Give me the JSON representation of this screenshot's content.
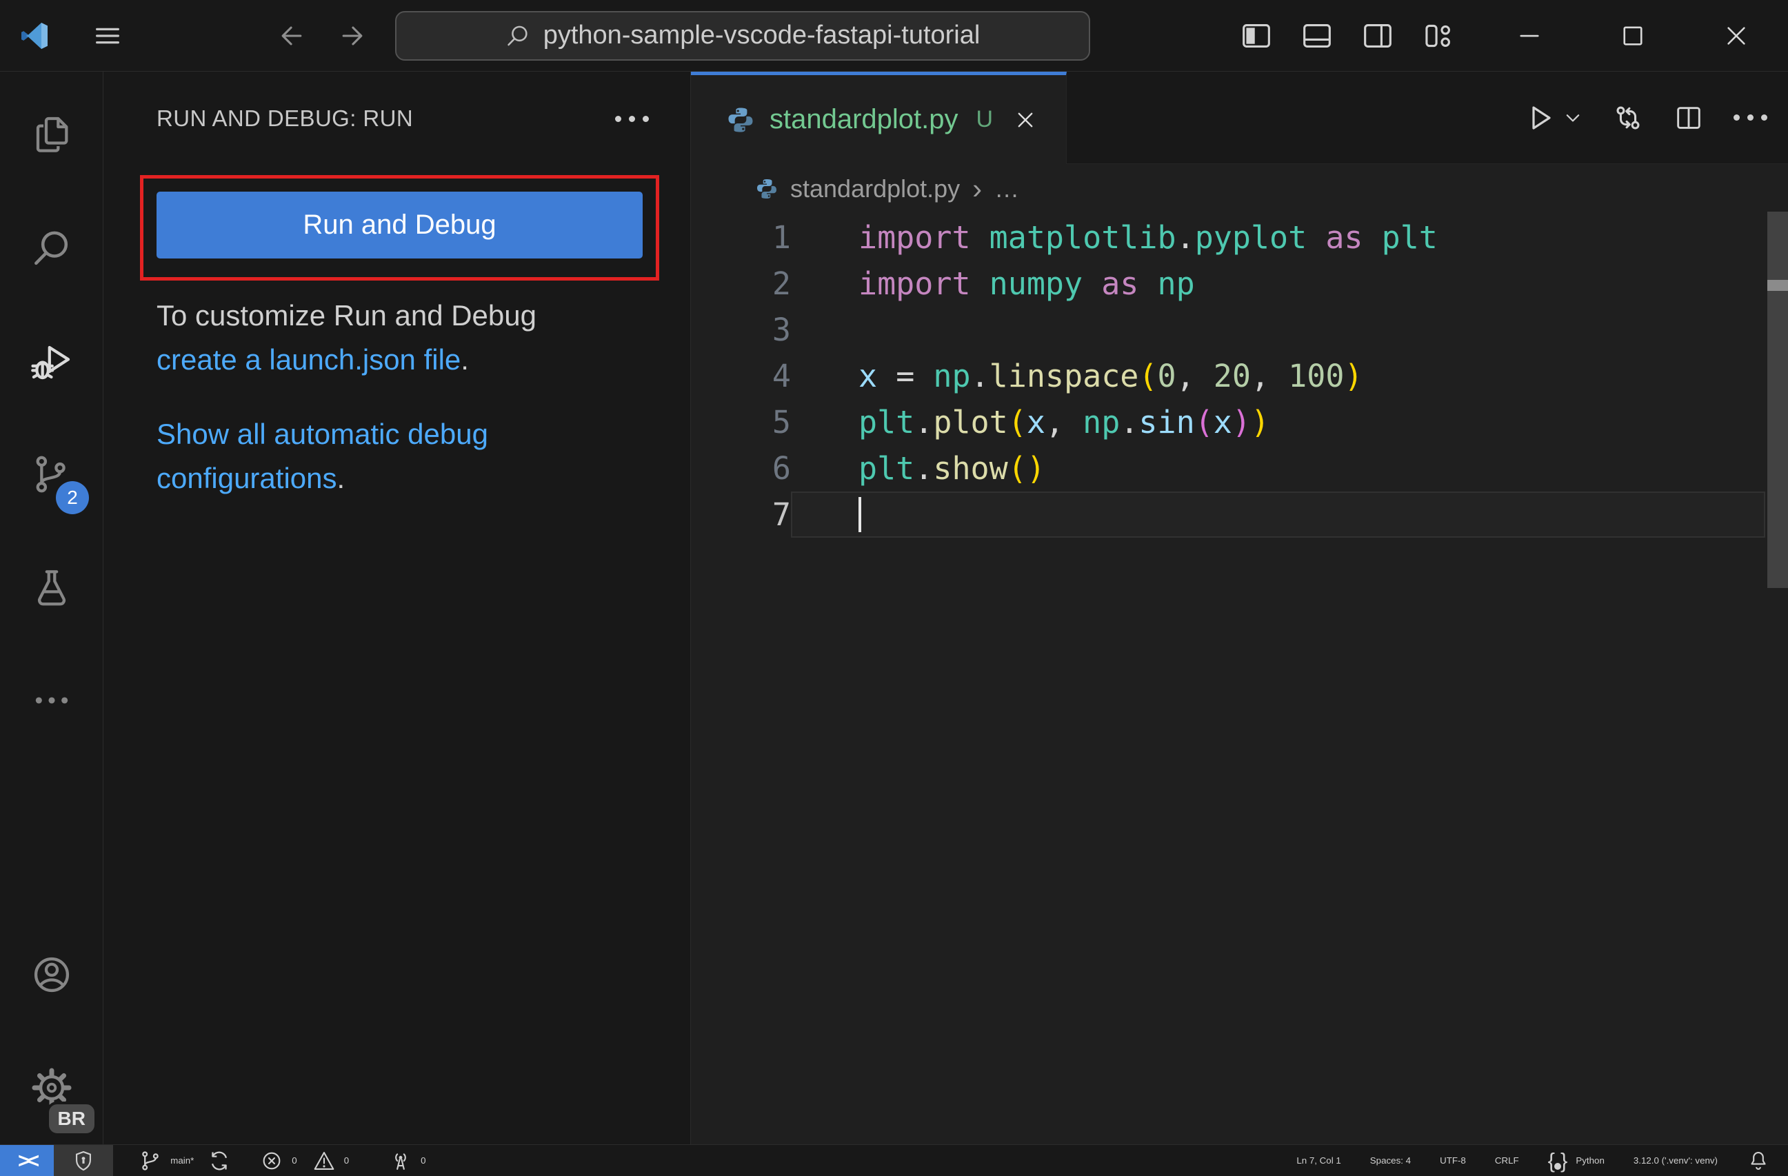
{
  "colors": {
    "bg": "#181818",
    "bg-editor": "#1f1f1f",
    "border": "#2b2b2b",
    "accent": "#3f7dd6",
    "link": "#4daafc",
    "untracked": "#73c991",
    "annotation": "#e32222"
  },
  "syntax_colors": {
    "kw": "#C586C0",
    "cls": "#4EC9B0",
    "fn": "#DCDCAA",
    "var": "#9CDCFE",
    "num": "#B5CEA8",
    "fg": "#D4D4D4",
    "b1": "#FFD700",
    "b2": "#DA70D6"
  },
  "icons": {
    "close": "✕",
    "breadcrumb_separator": "›",
    "breadcrumb_ellipsis": "…",
    "remote": "><",
    "brace_left": "{",
    "brace_right": "}"
  },
  "title_bar": {
    "search_value": "python-sample-vscode-fastapi-tutorial"
  },
  "activity_bar": {
    "source_control_badge": "2",
    "profile_badge": "BR"
  },
  "sidebar": {
    "header": "RUN AND DEBUG: RUN",
    "run_button_label": "Run and Debug",
    "customize_text": "To customize Run and Debug",
    "create_launch_link": "create a launch.json file",
    "create_launch_suffix": ".",
    "show_configs_link": "Show all automatic debug configurations",
    "show_configs_suffix": "."
  },
  "editor": {
    "tab": {
      "filename": "standardplot.py",
      "git_status": "U"
    },
    "breadcrumb": {
      "filename": "standardplot.py"
    },
    "code_lines": [
      {
        "num": "1",
        "tokens": [
          [
            "import",
            "kw"
          ],
          [
            " ",
            "fg"
          ],
          [
            "matplotlib",
            "cls"
          ],
          [
            ".",
            "fg"
          ],
          [
            "pyplot",
            "cls"
          ],
          [
            " ",
            "fg"
          ],
          [
            "as",
            "kw"
          ],
          [
            " ",
            "fg"
          ],
          [
            "plt",
            "cls"
          ]
        ]
      },
      {
        "num": "2",
        "tokens": [
          [
            "import",
            "kw"
          ],
          [
            " ",
            "fg"
          ],
          [
            "numpy",
            "cls"
          ],
          [
            " ",
            "fg"
          ],
          [
            "as",
            "kw"
          ],
          [
            " ",
            "fg"
          ],
          [
            "np",
            "cls"
          ]
        ]
      },
      {
        "num": "3",
        "tokens": []
      },
      {
        "num": "4",
        "tokens": [
          [
            "x",
            "var"
          ],
          [
            " ",
            "fg"
          ],
          [
            "=",
            "fg"
          ],
          [
            " ",
            "fg"
          ],
          [
            "np",
            "cls"
          ],
          [
            ".",
            "fg"
          ],
          [
            "linspace",
            "fn"
          ],
          [
            "(",
            "b1"
          ],
          [
            "0",
            "num"
          ],
          [
            ",",
            "fg"
          ],
          [
            " ",
            "fg"
          ],
          [
            "20",
            "num"
          ],
          [
            ",",
            "fg"
          ],
          [
            " ",
            "fg"
          ],
          [
            "100",
            "num"
          ],
          [
            ")",
            "b1"
          ]
        ]
      },
      {
        "num": "5",
        "tokens": [
          [
            "plt",
            "cls"
          ],
          [
            ".",
            "fg"
          ],
          [
            "plot",
            "fn"
          ],
          [
            "(",
            "b1"
          ],
          [
            "x",
            "var"
          ],
          [
            ",",
            "fg"
          ],
          [
            " ",
            "fg"
          ],
          [
            "np",
            "cls"
          ],
          [
            ".",
            "fg"
          ],
          [
            "sin",
            "var"
          ],
          [
            "(",
            "b2"
          ],
          [
            "x",
            "var"
          ],
          [
            ")",
            "b2"
          ],
          [
            ")",
            "b1"
          ]
        ]
      },
      {
        "num": "6",
        "tokens": [
          [
            "plt",
            "cls"
          ],
          [
            ".",
            "fg"
          ],
          [
            "show",
            "fn"
          ],
          [
            "(",
            "b1"
          ],
          [
            ")",
            "b1"
          ]
        ]
      },
      {
        "num": "7",
        "tokens": [],
        "current": true,
        "cursor": true
      }
    ]
  },
  "status_bar": {
    "branch": "main*",
    "errors": "0",
    "warnings": "0",
    "ports": "0",
    "cursor_position": "Ln 7, Col 1",
    "indentation": "Spaces: 4",
    "encoding": "UTF-8",
    "eol": "CRLF",
    "language": "Python",
    "interpreter": "3.12.0 ('.venv': venv)"
  }
}
